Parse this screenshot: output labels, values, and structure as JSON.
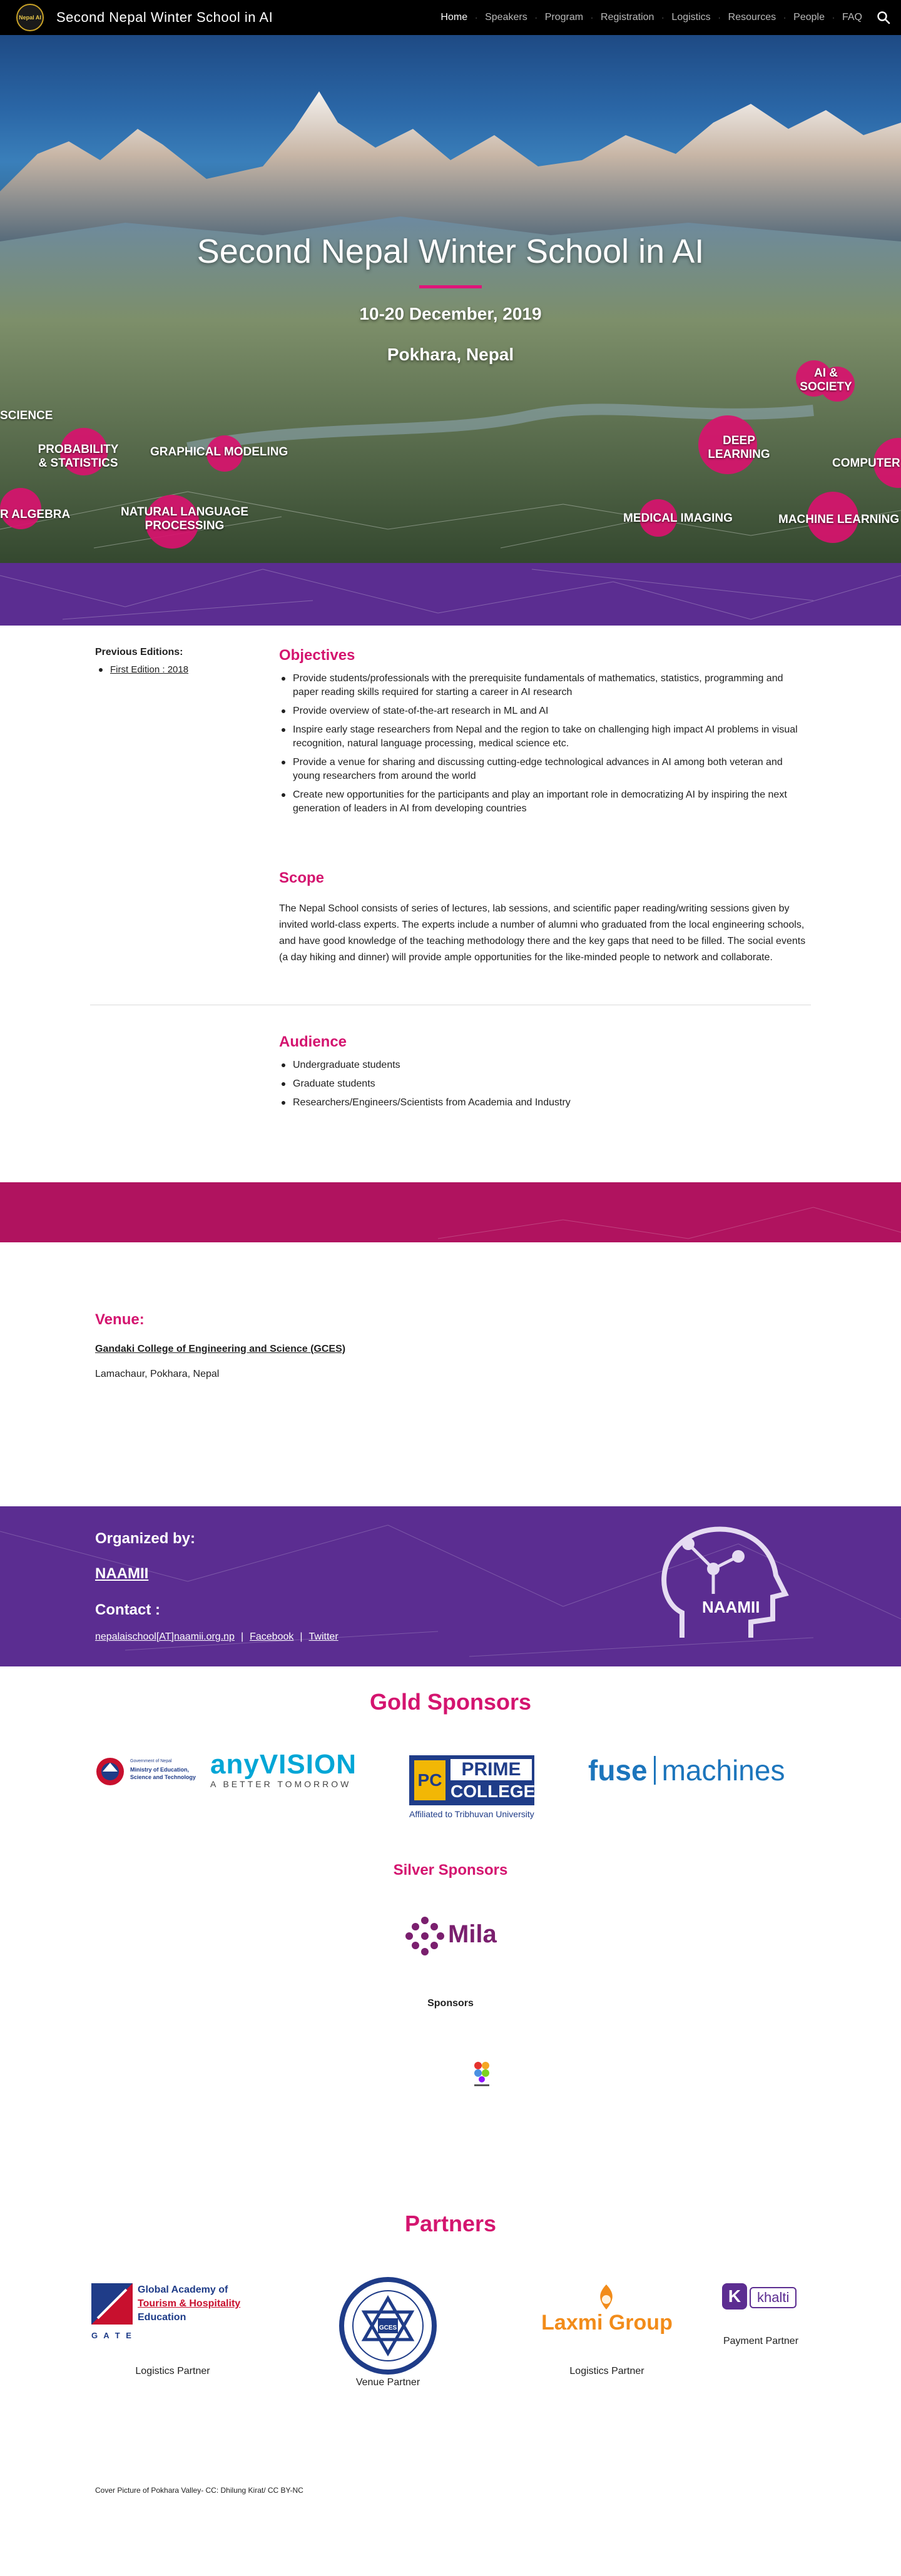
{
  "nav": {
    "logo_text": "Nepal AI",
    "title": "Second Nepal Winter School in AI",
    "links": [
      "Home",
      "Speakers",
      "Program",
      "Registration",
      "Logistics",
      "Resources",
      "People",
      "FAQ"
    ],
    "active": "Home",
    "search_icon": "search-icon"
  },
  "hero": {
    "title": "Second Nepal Winter School in AI",
    "date": "10-20 December, 2019",
    "location": "Pokhara, Nepal",
    "topics": {
      "science": "SCIENCE",
      "prob_stats_1": "PROBABILITY",
      "prob_stats_2": "& STATISTICS",
      "graphical": "GRAPHICAL MODELING",
      "linear_algebra": "R ALGEBRA",
      "nlp_1": "NATURAL LANGUAGE",
      "nlp_2": "PROCESSING",
      "ai_society_1": "AI &",
      "ai_society_2": "SOCIETY",
      "deep_1": "DEEP",
      "deep_2": "LEARNING",
      "computer": "COMPUTER",
      "medical": "MEDICAL IMAGING",
      "ml": "MACHINE LEARNING"
    },
    "accent": "#d8126e"
  },
  "previous": {
    "title": "Previous Editions:",
    "items": [
      "First Edition : 2018"
    ]
  },
  "objectives": {
    "heading": "Objectives",
    "items": [
      "Provide students/professionals with the prerequisite fundamentals of mathematics, statistics, programming and paper reading skills required for starting a career in AI research",
      "Provide overview of state-of-the-art research in ML and AI",
      "Inspire early stage researchers from Nepal and the region to take on challenging high impact AI problems in visual recognition, natural language processing, medical science etc.",
      "Provide a venue for sharing and discussing cutting-edge technological advances in AI among both veteran and young researchers from around the world",
      "Create new opportunities for the participants and play an important role in democratizing AI by inspiring the next generation of leaders in AI from developing countries"
    ]
  },
  "scope": {
    "heading": "Scope",
    "text": "The Nepal School consists of series of lectures, lab sessions, and scientific paper reading/writing sessions given by invited world-class experts. The experts include a number of alumni who graduated from the local engineering schools, and have good knowledge of the teaching methodology there and the key gaps that need to be filled. The social events (a day hiking and dinner) will provide ample opportunities for the like-minded people to network and collaborate."
  },
  "audience": {
    "heading": "Audience",
    "items": [
      "Undergraduate students",
      "Graduate students",
      "Researchers/Engineers/Scientists from Academia and Industry"
    ]
  },
  "venue": {
    "heading": "Venue:",
    "name": "Gandaki College of Engineering and Science (GCES)",
    "address": "Lamachaur, Pokhara, Nepal"
  },
  "organized": {
    "heading": "Organized by:",
    "name": "NAAMII",
    "contact_heading": "Contact :",
    "email": "nepalaischool[AT]naamii.org.np",
    "sep": "|",
    "facebook": "Facebook",
    "twitter": "Twitter",
    "logo_text": "NAAMII"
  },
  "sponsors": {
    "gold_heading": "Gold Sponsors",
    "gold": [
      {
        "line1": "Government of Nepal",
        "line2": "Ministry of Education,",
        "line3": "Science and Technology"
      },
      {
        "main": "anyVISION",
        "tag": "A BETTER TOMORROW"
      },
      {
        "badge": "PC",
        "name1": "PRIME",
        "name2": "COLLEGE",
        "tag": "Affiliated to Tribhuvan University"
      },
      {
        "a": "fuse",
        "b": "machines"
      }
    ],
    "silver_heading": "Silver Sponsors",
    "silver": [
      {
        "name": "Mila"
      }
    ],
    "sponsors_label": "Sponsors"
  },
  "partners": {
    "heading": "Partners",
    "items": [
      {
        "name1": "Global Academy of",
        "name2": "Tourism & Hospitality",
        "name3": "Education",
        "short": "G A T E",
        "role": "Logistics Partner"
      },
      {
        "name": "GCES",
        "role": "Venue Partner"
      },
      {
        "name": "Laxmi Group",
        "role": "Logistics Partner"
      },
      {
        "name": "khalti",
        "role": "Payment Partner"
      }
    ]
  },
  "footer": {
    "note": "Cover Picture of Pokhara Valley- CC: Dhilung Kirat/ CC BY-NC"
  }
}
